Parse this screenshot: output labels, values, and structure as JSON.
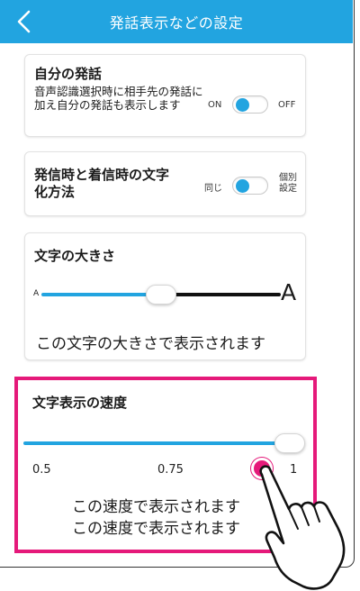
{
  "header": {
    "title": "発話表示などの設定",
    "back_icon": "chevron-left-icon"
  },
  "own_speech": {
    "title": "自分の発話",
    "description": "音声認識選択時に相手先の発話に加え自分の発話も表示します",
    "on_label": "ON",
    "off_label": "OFF",
    "state": "ON"
  },
  "char_method": {
    "title_line1": "発信時と着信時の文字",
    "title_line2": "化方法",
    "same_label": "同じ",
    "individual_line1": "個別",
    "individual_line2": "設定",
    "state": "同じ"
  },
  "text_size": {
    "title": "文字の大きさ",
    "small_label": "A",
    "large_label": "A",
    "value_fraction": 0.5,
    "sample": "この文字の大きさで表示されます"
  },
  "display_speed": {
    "title": "文字表示の速度",
    "ticks": [
      "0.5",
      "0.75",
      "1"
    ],
    "value": 1,
    "sample_line1": "この速度で表示されます",
    "sample_line2": "この速度で表示されます"
  },
  "colors": {
    "accent": "#22a4e0",
    "highlight": "#e5197a"
  }
}
